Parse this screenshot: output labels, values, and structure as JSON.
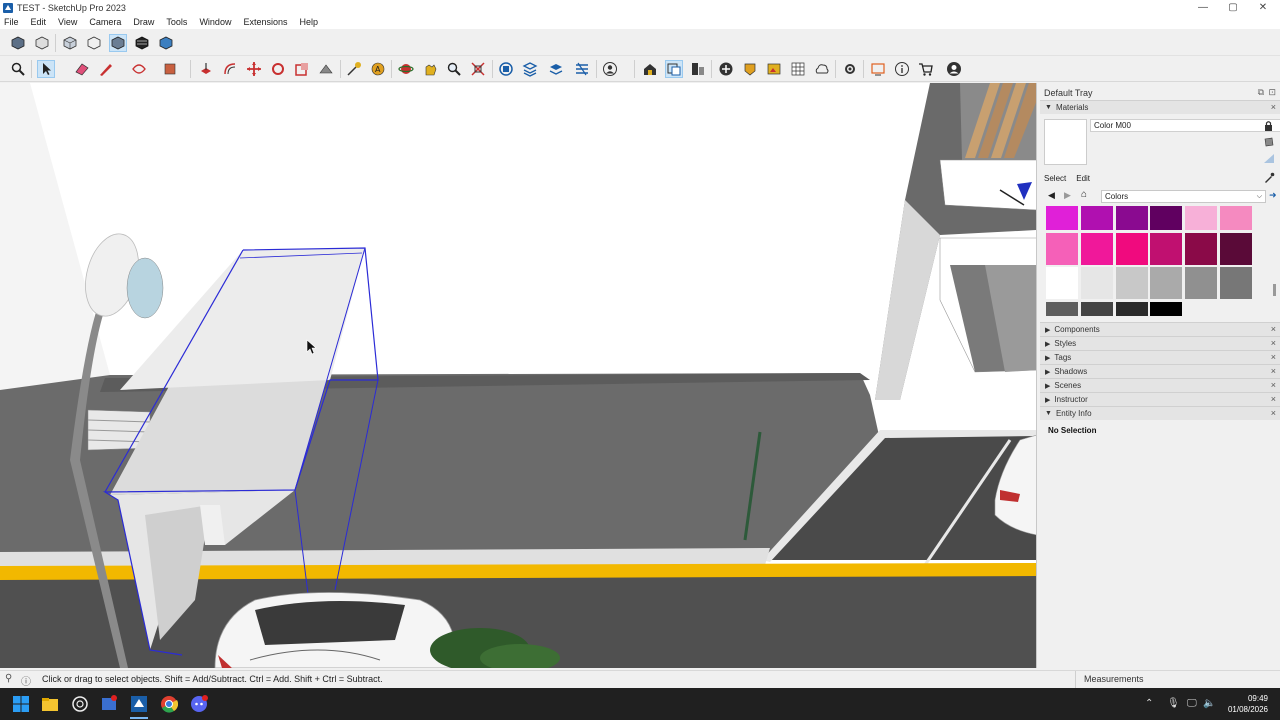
{
  "window": {
    "title": "TEST - SketchUp Pro 2023"
  },
  "menu": [
    "File",
    "Edit",
    "View",
    "Camera",
    "Draw",
    "Tools",
    "Window",
    "Extensions",
    "Help"
  ],
  "toolbar1_icons": [
    "iso-view-icon",
    "front-view-icon",
    "xray-icon",
    "wireframe-icon",
    "hidden-line-icon",
    "shaded-icon",
    "shaded-textures-icon"
  ],
  "toolbar2_icons": [
    "search-icon",
    "select-arrow-icon",
    "eraser-icon",
    "pencil-line-icon",
    "shapes-icon",
    "paint-bucket-icon",
    "push-pull-icon",
    "offset-icon",
    "move-icon",
    "rotate-icon",
    "scale-icon",
    "follow-me-icon",
    "tape-measure-icon",
    "text-icon",
    "orbit-icon",
    "pan-icon",
    "zoom-icon",
    "zoom-extents-icon",
    "outliner-icon",
    "layers-icon",
    "tags-icon",
    "styles-icon",
    "user-icon",
    "warehouse-icon",
    "extension-icon",
    "components-icon",
    "add-location-icon",
    "sandbox-icon",
    "photo-texture-icon",
    "section-icon",
    "cloud-icon",
    "settings-icon",
    "display-icon",
    "info-icon",
    "cart-icon",
    "account-icon"
  ],
  "tray": {
    "title": "Default Tray",
    "materials_label": "Materials",
    "material_name": "Color M00",
    "tab_select": "Select",
    "tab_edit": "Edit",
    "library": "Colors",
    "swatch_colors": [
      [
        "#e020d8",
        "#b010b0",
        "#8a0a90",
        "#600060",
        "#f7b0d8",
        "#f58ac0"
      ],
      [
        "#f560b8",
        "#f0189a",
        "#f00a7e",
        "#c01070",
        "#8a0a48",
        "#5a0a38"
      ],
      [
        "#ffffff",
        "#e6e6e6",
        "#c8c8c8",
        "#aaaaaa",
        "#909090",
        "#777777"
      ],
      [
        "#5e5e5e",
        "#444444",
        "#2a2a2a",
        "#000000"
      ]
    ],
    "panels": [
      "Components",
      "Styles",
      "Tags",
      "Shadows",
      "Scenes",
      "Instructor"
    ],
    "entity_info_label": "Entity Info",
    "entity_info_value": "No Selection"
  },
  "status": {
    "hint": "Click or drag to select objects. Shift = Add/Subtract. Ctrl = Add. Shift + Ctrl = Subtract.",
    "measurements_label": "Measurements"
  },
  "taskbar": {
    "time": "09:49",
    "date": "01/08/2026"
  }
}
